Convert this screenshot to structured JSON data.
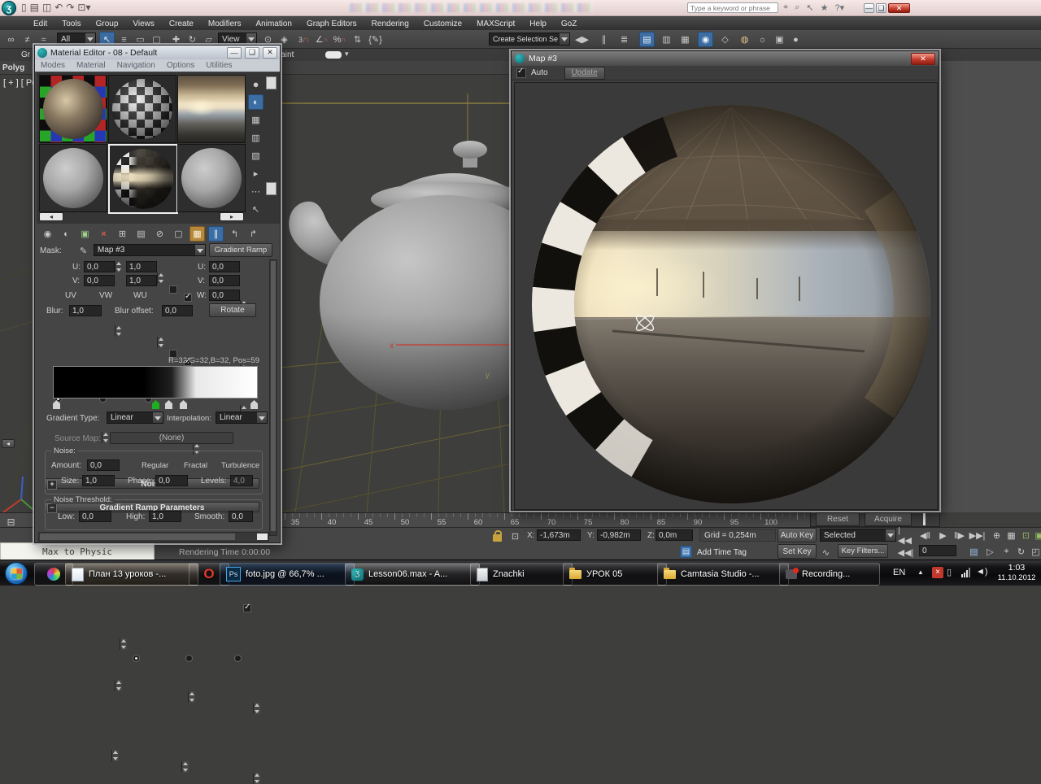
{
  "colors": {
    "accent_blue": "#3c6da3",
    "highlight_amber": "#b5883c",
    "close_red": "#c2392b",
    "viewport_grid": "#6b6234",
    "marker_green": "#1fae1f"
  },
  "titlebar": {
    "search_placeholder": "Type a keyword or phrase"
  },
  "menubar": {
    "items": [
      "Edit",
      "Tools",
      "Group",
      "Views",
      "Create",
      "Modifiers",
      "Animation",
      "Graph Editors",
      "Rendering",
      "Customize",
      "MAXScript",
      "Help",
      "GoZ"
    ]
  },
  "toolbar": {
    "selection_filter": "All",
    "ref_coord": "View",
    "named_selections": "Create Selection Se",
    "snaps_label": "3"
  },
  "ribbon": {
    "tab_left": "Gr",
    "tab_right": "t Paint",
    "panel": "Polyg"
  },
  "viewport": {
    "label": "[ + ] [ Pe",
    "axis_x": "x",
    "axis_y": "y"
  },
  "material_editor": {
    "title": "Material Editor - 08 - Default",
    "menus": [
      "Modes",
      "Material",
      "Navigation",
      "Options",
      "Utilities"
    ],
    "mask_label": "Mask:",
    "map_name": "Map #3",
    "type_button": "Gradient Ramp",
    "coords": {
      "u_label": "U:",
      "v_label": "V:",
      "w_label": "W:",
      "u_off": "0,0",
      "u_tile": "1,0",
      "v_off": "0,0",
      "v_tile": "1,0",
      "u2": "0,0",
      "v2": "0,0",
      "w2": "0,0",
      "uv": "UV",
      "vw": "VW",
      "wu": "WU",
      "blur_label": "Blur:",
      "blur": "1,0",
      "blur_offset_label": "Blur offset:",
      "blur_offset": "0,0",
      "rotate": "Rotate"
    },
    "rollouts": {
      "noise": "Noise",
      "gradient": "Gradient Ramp Parameters"
    },
    "ramp": {
      "info": "R=32,G=32,B=32, Pos=59",
      "type_label": "Gradient Type:",
      "type": "Linear",
      "interp_label": "Interpolation:",
      "interp": "Linear"
    },
    "source": {
      "label": "Source Map:",
      "value": "(None)"
    },
    "noise": {
      "legend": "Noise:",
      "amount_label": "Amount:",
      "amount": "0,0",
      "regular": "Regular",
      "fractal": "Fractal",
      "turbulence": "Turbulence",
      "size_label": "Size:",
      "size": "1,0",
      "phase_label": "Phase:",
      "phase": "0,0",
      "levels_label": "Levels:",
      "levels": "4,0"
    },
    "threshold": {
      "legend": "Noise Threshold:",
      "low_label": "Low:",
      "low": "0,0",
      "high_label": "High:",
      "high": "1,0",
      "smooth_label": "Smooth:",
      "smooth": "0,0"
    }
  },
  "map_window": {
    "title": "Map #3",
    "auto_label": "Auto",
    "update": "Update",
    "reset": "Reset",
    "acquire": "Acquire"
  },
  "timeline": {
    "ticks": [
      "35",
      "40",
      "45",
      "50",
      "55",
      "60",
      "65",
      "70",
      "75",
      "80",
      "85",
      "90",
      "95",
      "100"
    ]
  },
  "status": {
    "x_label": "X:",
    "x_value": "-1,673m",
    "y_label": "Y:",
    "y_value": "-0,982m",
    "z_label": "Z:",
    "z_value": "0,0m",
    "grid": "Grid = 0,254m",
    "add_time_tag": "Add Time Tag",
    "auto_key": "Auto Key",
    "set_key": "Set Key",
    "selected": "Selected",
    "key_filters": "Key Filters...",
    "frame": "0",
    "rendering_time": "Rendering Time  0:00:00",
    "max_to_physic": "Max to Physic"
  },
  "taskbar": {
    "ps_badge": "Ps",
    "buttons": [
      {
        "label": "План 13 уроков -..."
      },
      {
        "label": "foto.jpg @ 66,7% ..."
      },
      {
        "label": "Lesson06.max - A..."
      },
      {
        "label": "Znachki"
      },
      {
        "label": "УРОК 05"
      },
      {
        "label": "Camtasia Studio -..."
      },
      {
        "label": "Recording..."
      }
    ],
    "tray": {
      "lang": "EN",
      "time": "1:03",
      "date": "11.10.2012"
    }
  }
}
